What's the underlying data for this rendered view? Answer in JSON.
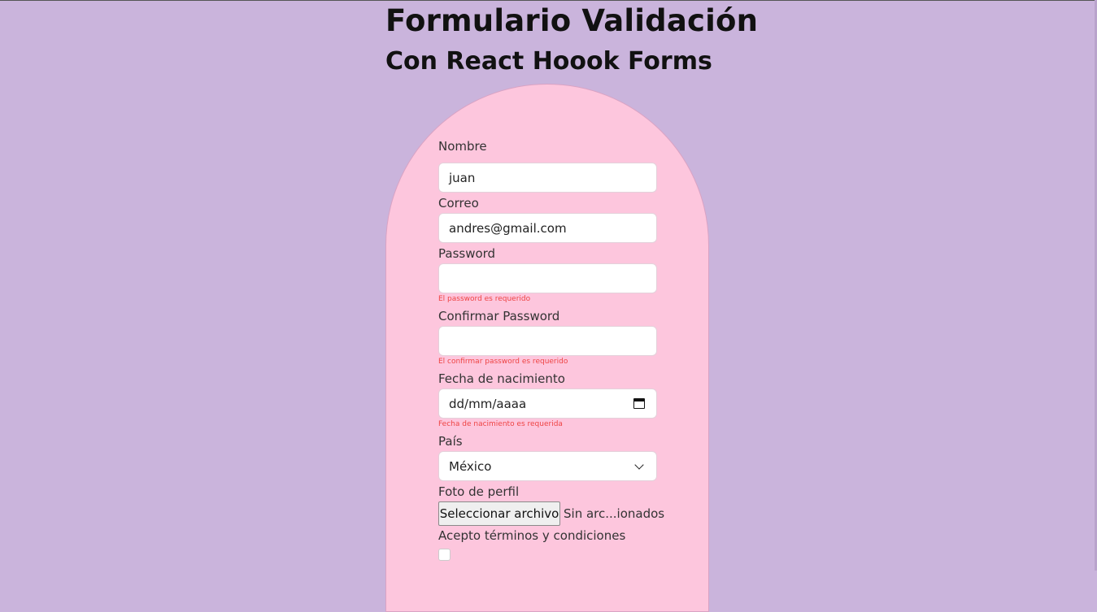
{
  "header": {
    "title": "Formulario Validación",
    "subtitle": "Con React Hoook Forms"
  },
  "form": {
    "nombre": {
      "label": "Nombre",
      "value": "juan"
    },
    "correo": {
      "label": "Correo",
      "value": "andres@gmail.com"
    },
    "password": {
      "label": "Password",
      "value": "",
      "error": "El password es requerido"
    },
    "confirm_password": {
      "label": "Confirmar Password",
      "value": "",
      "error": "El confirmar password es requerido"
    },
    "fecha": {
      "label": "Fecha de nacimiento",
      "placeholder": "dd/mm/aaaa",
      "error": "Fecha de nacimiento es requerida",
      "icon": "calendar-icon"
    },
    "pais": {
      "label": "País",
      "value": "México",
      "icon": "chevron-down-icon"
    },
    "foto": {
      "label": "Foto de perfil",
      "button_label": "Seleccionar archivo",
      "status": "Sin arc...ionados"
    },
    "terminos": {
      "label": "Acepto términos y condiciones",
      "checked": false
    }
  },
  "colors": {
    "background": "#cab4dc",
    "card": "#fdc6dd",
    "error": "#ee4444"
  }
}
